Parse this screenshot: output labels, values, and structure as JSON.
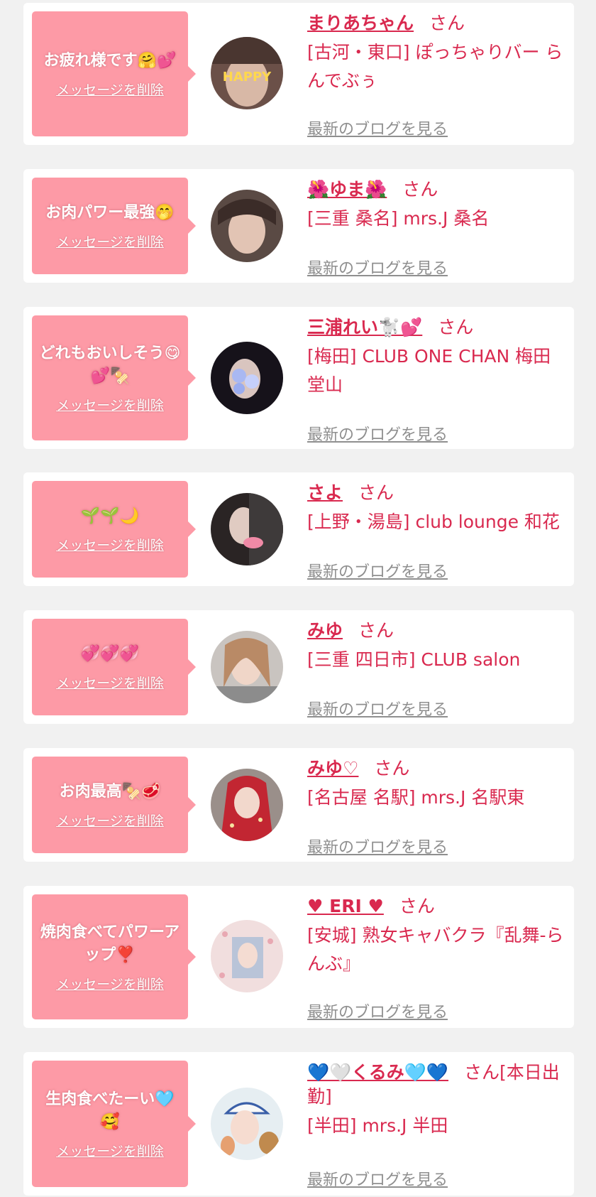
{
  "delete_label": "メッセージを削除",
  "blog_label": "最新のブログを見る",
  "suffix": "さん",
  "colors": {
    "background": "#f1f1f1",
    "bubble": "#fd9aa6",
    "name": "#d9294f",
    "blog_link": "#8f8f8f"
  },
  "items": [
    {
      "message": "お疲れ様です🤗💕",
      "name": "まりあちゃん",
      "suffix": "さん",
      "shop": "[古河・東口] ぽっちゃりバー らんでぶぅ"
    },
    {
      "message": "お肉パワー最強🤭",
      "name": "🌺ゆま🌺",
      "suffix": "さん",
      "shop": "[三重 桑名] mrs.J 桑名"
    },
    {
      "message": "どれもおいしそう😋💕🍢",
      "name": "三浦れい🐩💕",
      "suffix": "さん",
      "shop": "[梅田] CLUB ONE CHAN 梅田堂山"
    },
    {
      "message": "🌱🌱🌙",
      "name": "さよ",
      "suffix": "さん",
      "shop": "[上野・湯島] club lounge 和花"
    },
    {
      "message": "💞💞💞",
      "name": "みゆ",
      "suffix": "さん",
      "shop": "[三重 四日市] CLUB salon"
    },
    {
      "message": "お肉最高🍢🥩",
      "name": "みゆ♡",
      "suffix": "さん",
      "shop": "[名古屋 名駅] mrs.J 名駅東"
    },
    {
      "message": "焼肉食べてパワーアップ❣️",
      "name": "♥ ERI ♥",
      "suffix": "さん",
      "shop": "[安城] 熟女キャバクラ『乱舞-らんぶ』"
    },
    {
      "message": "生肉食べたーい🩵🥰",
      "name": "💙🤍くるみ🩵💙",
      "suffix": "さん[本日出勤]",
      "shop": "[半田] mrs.J 半田"
    }
  ]
}
